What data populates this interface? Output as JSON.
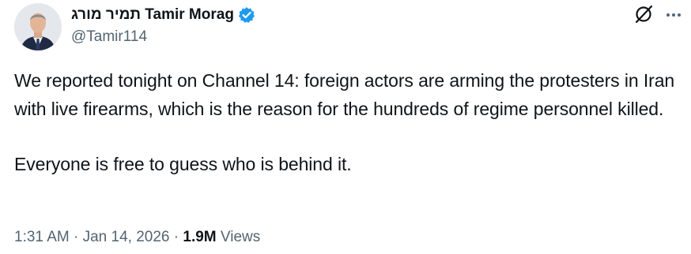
{
  "author": {
    "display_name": "תמיר מורג Tamir Morag",
    "handle": "@Tamir114",
    "verified": true
  },
  "icons": {
    "verified": "verified-badge-icon",
    "grok": "grok-icon",
    "more": "more-options-icon",
    "avatar": "avatar"
  },
  "tweet": {
    "paragraphs": [
      "We reported tonight on Channel 14: foreign actors are arming the protesters in Iran with live firearms, which is the reason for the hundreds of regime personnel killed.",
      "Everyone is free to guess who is behind it."
    ]
  },
  "meta": {
    "time": "1:31 AM",
    "separator": "·",
    "date": "Jan 14, 2026",
    "views_count": "1.9M",
    "views_label": "Views"
  },
  "colors": {
    "text_primary": "#0f1419",
    "text_secondary": "#536471",
    "verified_blue": "#1d9bf0"
  }
}
